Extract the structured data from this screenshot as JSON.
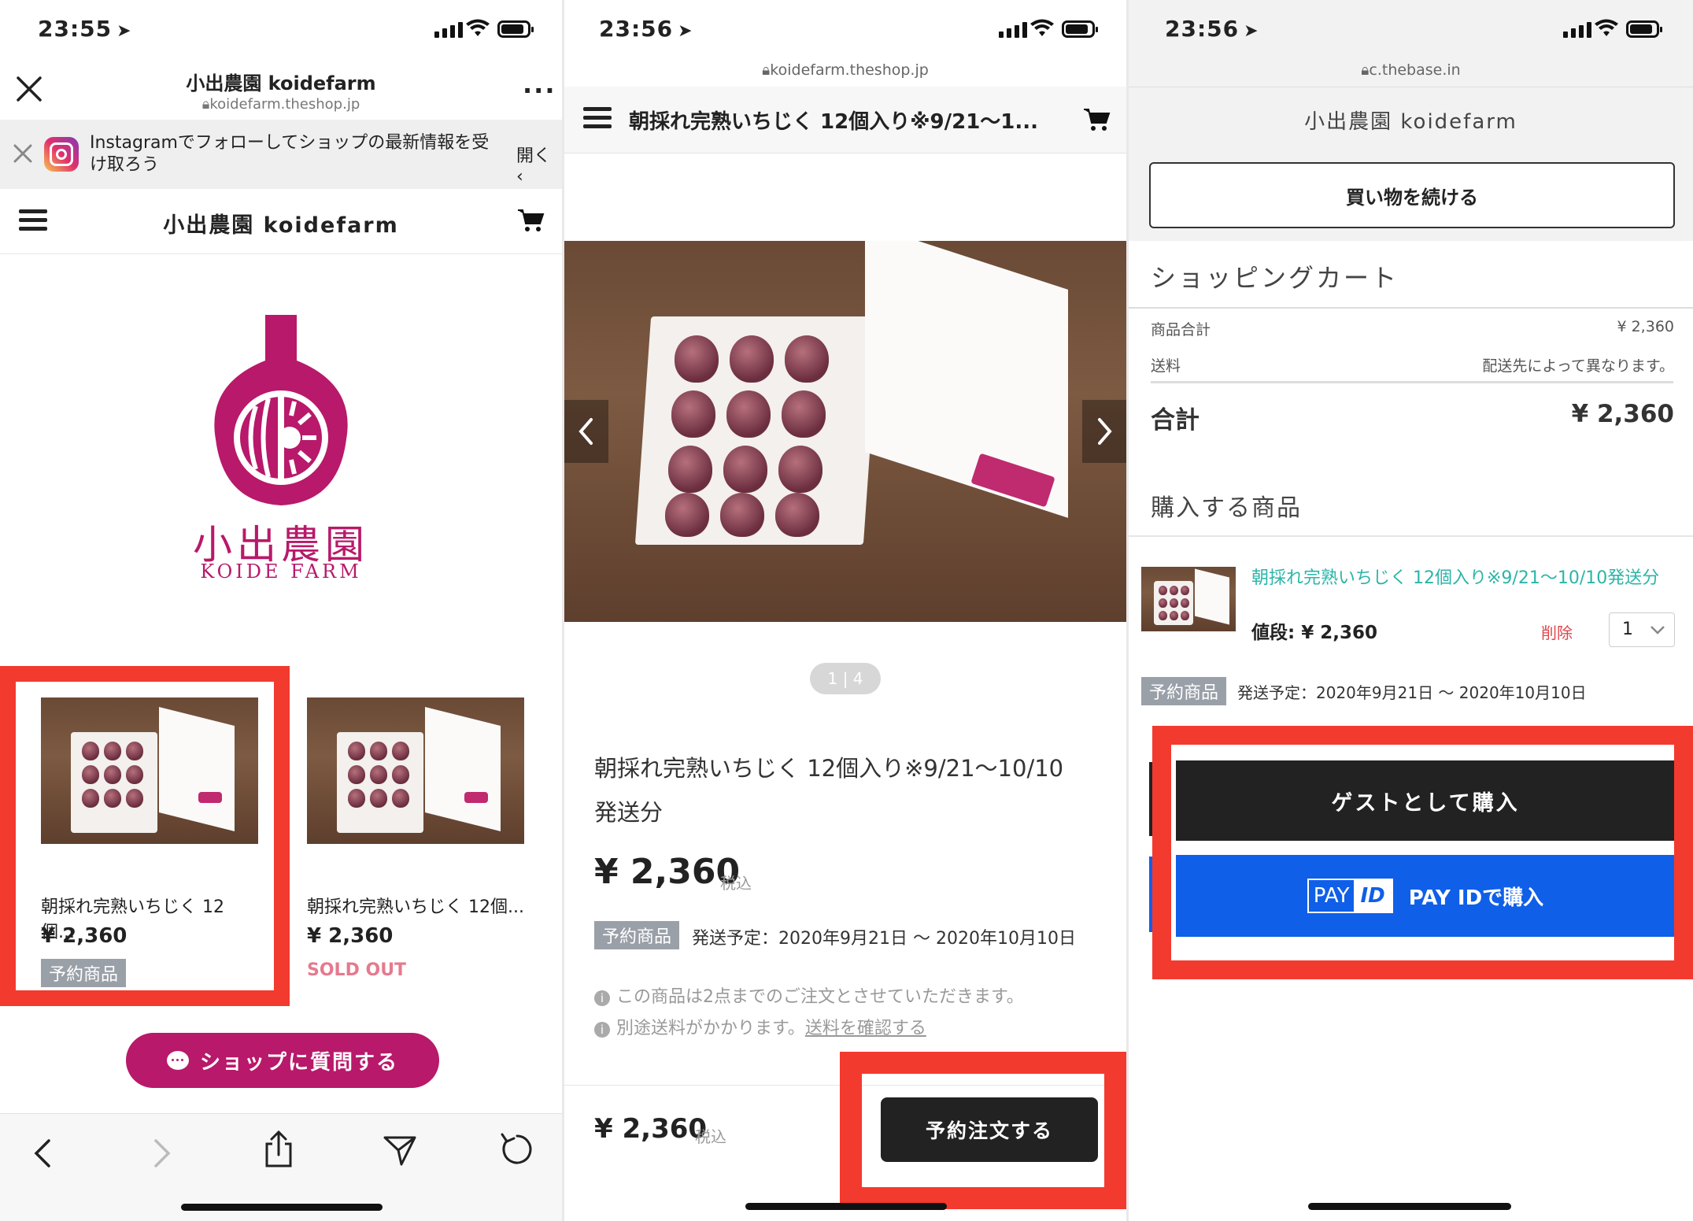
{
  "screen1": {
    "status_time": "23:55",
    "close_icon": "close-icon",
    "title": "小出農園 koidefarm",
    "url": "koidefarm.theshop.jp",
    "more_icon": "more-icon",
    "banner": {
      "text_line1": "Instagramでフォローしてショップの最新情報を受",
      "text_line2": "け取ろう",
      "open_label": "開く"
    },
    "shop_name": "小出農園 koidefarm",
    "logo": {
      "kanji": "小出農園",
      "latin": "KOIDE FARM",
      "color": "#b8196a"
    },
    "products": [
      {
        "name": "朝採れ完熟いちじく 12個...",
        "price": "¥ 2,360",
        "badge": "予約商品"
      },
      {
        "name": "朝採れ完熟いちじく 12個...",
        "price": "¥ 2,360",
        "status": "SOLD OUT"
      }
    ],
    "ask_button": "ショップに質問する",
    "nav_icons": [
      "back-icon",
      "forward-icon",
      "share-icon",
      "send-icon",
      "reload-icon"
    ]
  },
  "screen2": {
    "status_time": "23:56",
    "url": "koidefarm.theshop.jp",
    "header_title": "朝採れ完熟いちじく 12個入り※9/21〜1...",
    "pager": "1 | 4",
    "product_title_line1": "朝採れ完熟いちじく 12個入り※9/21〜10/10",
    "product_title_line2": "発送分",
    "price": "¥ 2,360",
    "tax_label": "税込",
    "badge": "予約商品",
    "ship_text": "発送予定：2020年9月21日 〜 2020年10月10日",
    "note1": "この商品は2点までのご注文とさせていただきます。",
    "note2_prefix": "別途送料がかかります。",
    "note2_link": "送料を確認する",
    "footer_price": "¥ 2,360",
    "footer_tax": "税込",
    "order_button": "予約注文する"
  },
  "screen3": {
    "status_time": "23:56",
    "url": "c.thebase.in",
    "shop_name": "小出農園 koidefarm",
    "continue_button": "買い物を続ける",
    "cart_title": "ショッピングカート",
    "subtotal_label": "商品合計",
    "subtotal_value": "¥ 2,360",
    "shipping_label": "送料",
    "shipping_value": "配送先によって異なります。",
    "total_label": "合計",
    "total_value": "¥ 2,360",
    "items_title": "購入する商品",
    "item_name": "朝採れ完熟いちじく 12個入り※9/21〜10/10発送分",
    "item_price_label": "値段: ¥ 2,360",
    "delete_label": "削除",
    "quantity": "1",
    "badge": "予約商品",
    "ship_text": "発送予定：2020年9月21日 〜 2020年10月10日",
    "guest_button": "ゲストとして購入",
    "payid_logo_pay": "PAY",
    "payid_logo_id": "ID",
    "payid_button": "PAY IDで購入"
  },
  "colors": {
    "highlight": "#f33a2e",
    "brand": "#b8196a",
    "payid_blue": "#0f5fe8",
    "link_teal": "#2bb5a8",
    "delete_red": "#e0444a"
  }
}
